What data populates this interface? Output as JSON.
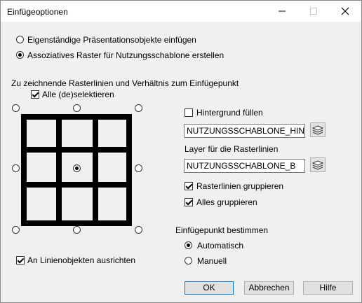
{
  "window": {
    "title": "Einfügeoptionen",
    "minimize_icon": "minimize-icon",
    "maximize_icon": "maximize-icon",
    "close_icon": "close-icon"
  },
  "mode": {
    "option1_label": "Eigenständige Präsentationsobjekte einfügen",
    "option2_label": "Assoziatives Raster für Nutzungsschablone erstellen",
    "selected": "option2"
  },
  "grid_section": {
    "heading": "Zu zeichnende Rasterlinien und Verhältnis zum Einfügepunkt",
    "select_all_label": "Alle (de)selektieren",
    "select_all_checked": true,
    "selected_anchor": "center"
  },
  "align_label": "An Linienobjekten ausrichten",
  "align_checked": true,
  "background": {
    "fill_label": "Hintergrund füllen",
    "fill_checked": false,
    "layer_value": "NUTZUNGSSCHABLONE_HINTE",
    "layer_button_icon": "layers-icon"
  },
  "grid_layer": {
    "label": "Layer für die Rasterlinien",
    "value": "NUTZUNGSSCHABLONE_B",
    "button_icon": "layers-icon"
  },
  "group_lines_label": "Rasterlinien gruppieren",
  "group_lines_checked": true,
  "group_all_label": "Alles gruppieren",
  "group_all_checked": true,
  "insertion": {
    "heading": "Einfügepunkt bestimmen",
    "auto_label": "Automatisch",
    "manual_label": "Manuell",
    "selected": "auto"
  },
  "buttons": {
    "ok": "OK",
    "cancel": "Abbrechen",
    "help": "Hilfe"
  }
}
